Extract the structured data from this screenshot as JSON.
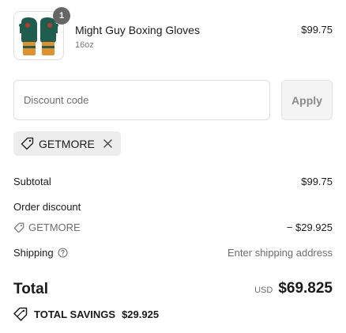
{
  "line_item": {
    "title": "Might Guy Boxing Gloves",
    "variant": "16oz",
    "price": "$99.75",
    "quantity": "1",
    "image_icon": "boxing-gloves-image"
  },
  "discount": {
    "placeholder": "Discount code",
    "apply_label": "Apply",
    "applied_code": "GETMORE",
    "tag_icon": "tag-icon",
    "remove_icon": "close-icon"
  },
  "summary": {
    "subtotal_label": "Subtotal",
    "subtotal_value": "$99.75",
    "order_discount_label": "Order discount",
    "order_discount_code": "GETMORE",
    "order_discount_value": "− $29.925",
    "shipping_label": "Shipping",
    "shipping_value": "Enter shipping address",
    "help_icon": "help-circle-icon"
  },
  "total": {
    "label": "Total",
    "currency": "USD",
    "value": "$69.825"
  },
  "savings": {
    "label": "TOTAL SAVINGS",
    "value": "$29.925",
    "icon": "savings-tag-icon"
  },
  "colors": {
    "badge": "#666666",
    "glove_green": "#1f5e4f",
    "glove_orange": "#e0902c",
    "muted_text": "#6e6e6e",
    "chip_bg": "#ededed"
  }
}
